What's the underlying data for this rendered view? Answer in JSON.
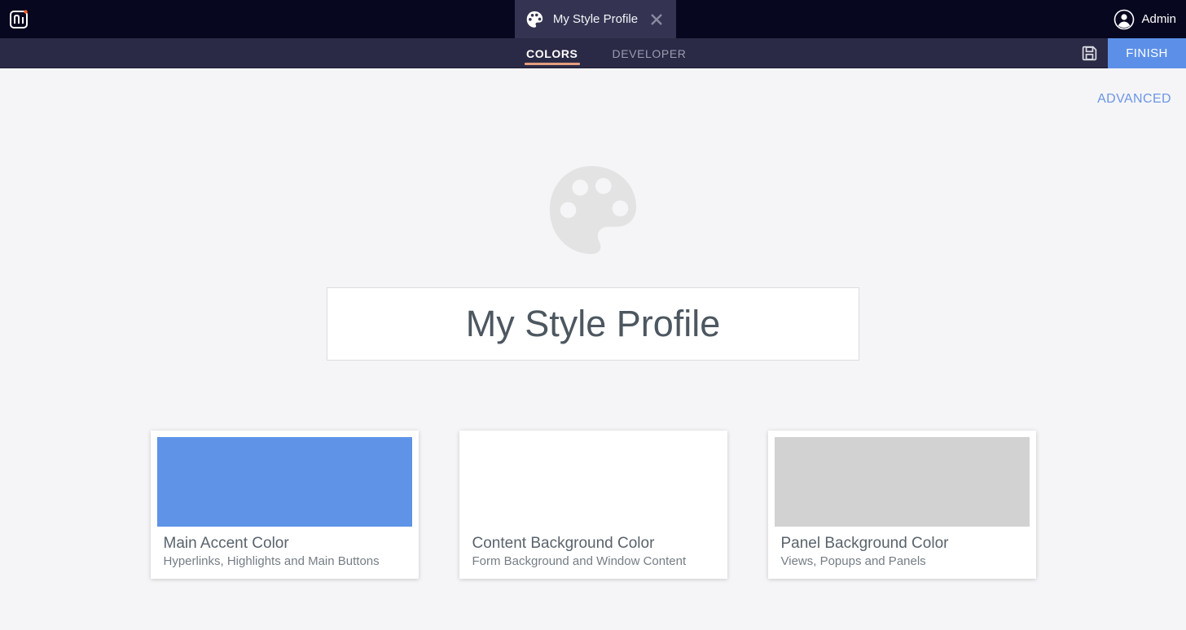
{
  "topbar": {
    "user_name": "Admin"
  },
  "tab": {
    "title": "My Style Profile"
  },
  "toolbar": {
    "tabs": [
      {
        "label": "COLORS",
        "active": true
      },
      {
        "label": "DEVELOPER",
        "active": false
      }
    ],
    "finish_label": "FINISH"
  },
  "content": {
    "advanced_label": "ADVANCED",
    "profile_title": "My Style Profile",
    "cards": [
      {
        "title": "Main Accent Color",
        "subtitle": "Hyperlinks, Highlights and Main Buttons",
        "swatch": "#5e93e7"
      },
      {
        "title": "Content Background Color",
        "subtitle": "Form Background and Window Content",
        "swatch": "#ffffff"
      },
      {
        "title": "Panel Background Color",
        "subtitle": "Views, Popups and Panels",
        "swatch": "#d2d2d2"
      }
    ]
  },
  "colors": {
    "topbar_bg": "#070720",
    "toolbar_bg": "#2a2a46",
    "tab_bg": "#343452",
    "active_tab_underline": "#e59d7d",
    "accent_blue": "#5c90e8",
    "link_blue": "#6b95e6",
    "page_bg": "#f5f5f7",
    "logo_dot_orange": "#ff5c1f"
  }
}
